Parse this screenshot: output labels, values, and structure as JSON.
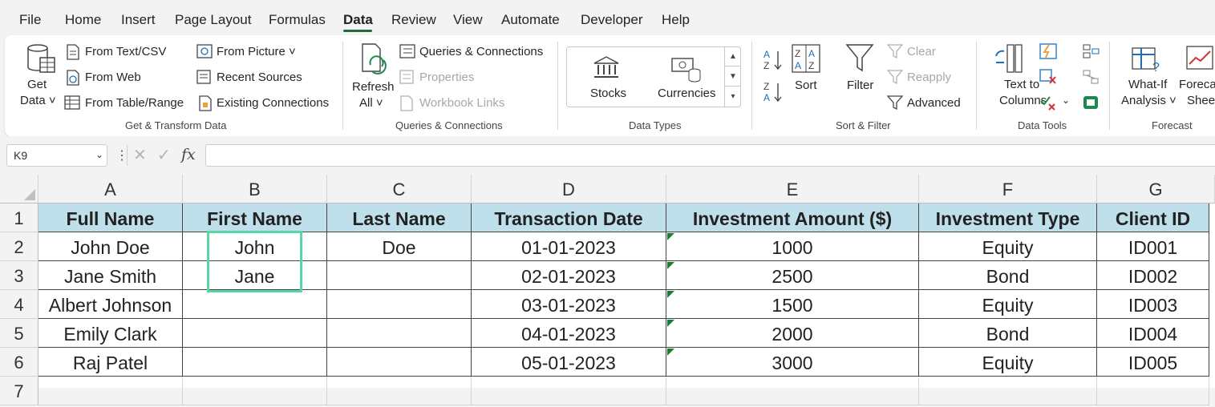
{
  "menu": {
    "tabs": [
      "File",
      "Home",
      "Insert",
      "Page Layout",
      "Formulas",
      "Data",
      "Review",
      "View",
      "Automate",
      "Developer",
      "Help"
    ],
    "active": "Data"
  },
  "ribbon": {
    "get_transform": {
      "get_data_1": "Get",
      "get_data_2": "Data ˅",
      "from_text_csv": "From Text/CSV",
      "from_web": "From Web",
      "from_table_range": "From Table/Range",
      "from_picture": "From Picture ˅",
      "recent_sources": "Recent Sources",
      "existing_connections": "Existing Connections",
      "group_label": "Get & Transform Data"
    },
    "queries": {
      "refresh_1": "Refresh",
      "refresh_2": "All ˅",
      "queries_connections": "Queries & Connections",
      "properties": "Properties",
      "workbook_links": "Workbook Links",
      "group_label": "Queries & Connections"
    },
    "data_types": {
      "stocks": "Stocks",
      "currencies": "Currencies",
      "group_label": "Data Types"
    },
    "sort_filter": {
      "sort": "Sort",
      "filter": "Filter",
      "clear": "Clear",
      "reapply": "Reapply",
      "advanced": "Advanced",
      "group_label": "Sort & Filter"
    },
    "data_tools": {
      "text_to_1": "Text to",
      "text_to_2": "Columns",
      "group_label": "Data Tools"
    },
    "forecast": {
      "what_if_1": "What-If",
      "what_if_2": "Analysis ˅",
      "forecast_1": "Forecast",
      "forecast_2": "Sheet",
      "group_label": "Forecast"
    }
  },
  "formula_bar": {
    "name_box": "K9",
    "fx": "fx",
    "formula": ""
  },
  "sheet": {
    "columns": [
      "A",
      "B",
      "C",
      "D",
      "E",
      "F",
      "G"
    ],
    "rows": [
      "1",
      "2",
      "3",
      "4",
      "5",
      "6",
      "7"
    ],
    "header": [
      "Full Name",
      "First Name",
      "Last Name",
      "Transaction Date",
      "Investment Amount ($)",
      "Investment Type",
      "Client ID"
    ],
    "data": [
      [
        "John Doe",
        "John",
        "Doe",
        "01-01-2023",
        "1000",
        "Equity",
        "ID001"
      ],
      [
        "Jane Smith",
        "Jane",
        "",
        "02-01-2023",
        "2500",
        "Bond",
        "ID002"
      ],
      [
        "Albert Johnson",
        "",
        "",
        "03-01-2023",
        "1500",
        "Equity",
        "ID003"
      ],
      [
        "Emily Clark",
        "",
        "",
        "04-01-2023",
        "2000",
        "Bond",
        "ID004"
      ],
      [
        "Raj Patel",
        "",
        "",
        "05-01-2023",
        "3000",
        "Equity",
        "ID005"
      ]
    ],
    "selected_range": "B2:B3"
  },
  "colors": {
    "header_fill": "#bfe0ea",
    "accent": "#1e6b3f",
    "selection": "#58d6a3"
  }
}
